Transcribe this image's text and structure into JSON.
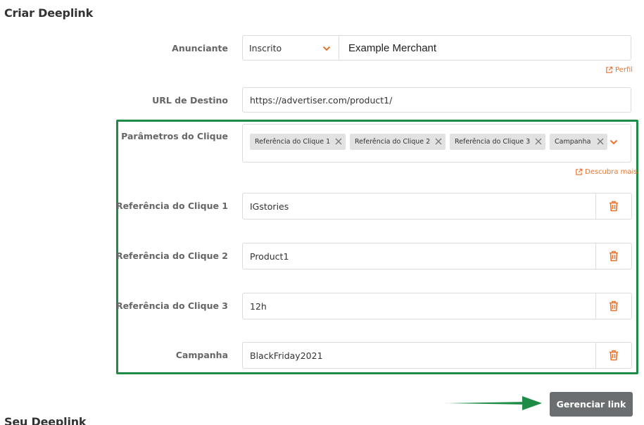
{
  "page": {
    "title": "Criar Deeplink",
    "next_section_title": "Seu Deeplink"
  },
  "advertiser": {
    "label": "Anunciante",
    "status_value": "Inscrito",
    "merchant_value": "Example Merchant",
    "profile_link": "Perfil"
  },
  "destination": {
    "label": "URL de Destino",
    "value": "https://advertiser.com/product1/"
  },
  "click_params": {
    "label": "Parâmetros do Clique",
    "tags": [
      "Referência do Clique 1",
      "Referência do Clique 2",
      "Referência do Clique 3",
      "Campanha"
    ],
    "learn_more": "Descubra mais."
  },
  "refs": [
    {
      "label": "Referência do Clique 1",
      "value": "IGstories"
    },
    {
      "label": "Referência do Clique 2",
      "value": "Product1"
    },
    {
      "label": "Referência do Clique 3",
      "value": "12h"
    },
    {
      "label": "Campanha",
      "value": "BlackFriday2021"
    }
  ],
  "actions": {
    "manage_label": "Gerenciar link"
  },
  "colors": {
    "accent": "#e8742f",
    "highlight": "#1e8c46",
    "button": "#6b6e70"
  }
}
